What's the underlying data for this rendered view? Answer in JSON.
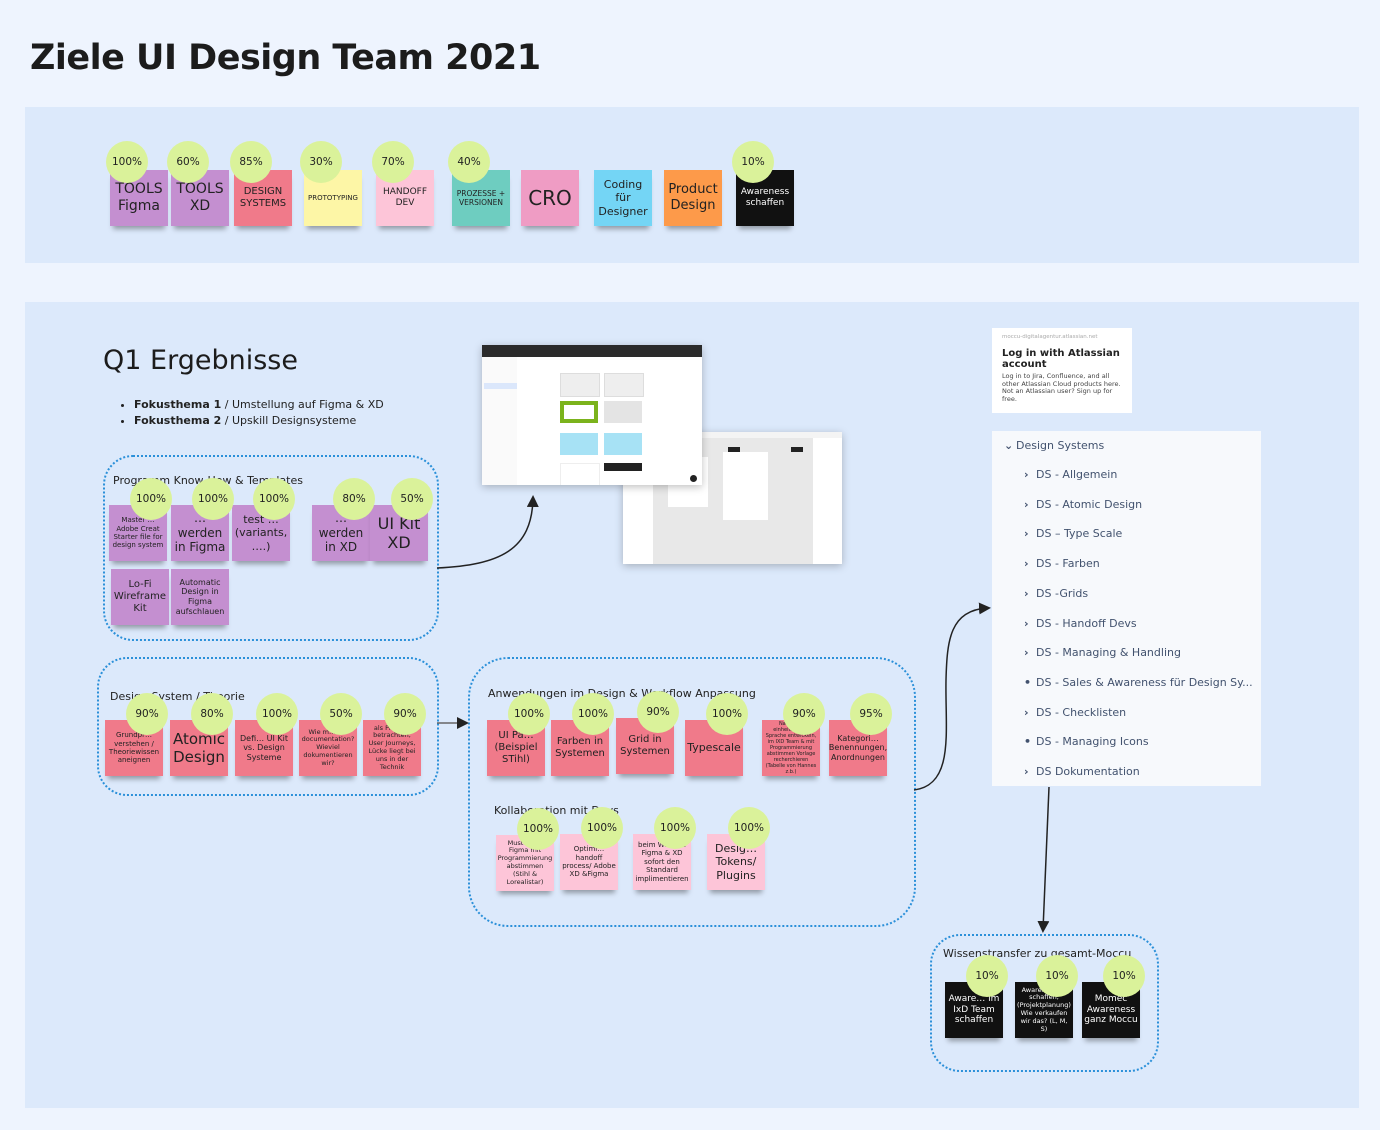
{
  "title": "Ziele UI Design Team 2021",
  "goals": [
    {
      "label": "TOOLS Figma",
      "progress": "100%",
      "color": "#c48fd0"
    },
    {
      "label": "TOOLS XD",
      "progress": "60%",
      "color": "#c48fd0"
    },
    {
      "label": "DESIGN SYSTEMS",
      "progress": "85%",
      "color": "#f07a8a"
    },
    {
      "label": "PROTOTYPING",
      "progress": "30%",
      "color": "#fdf6a6"
    },
    {
      "label": "HANDOFF DEV",
      "progress": "70%",
      "color": "#fdc5d8"
    },
    {
      "label": "PROZESSE + VERSIONEN",
      "progress": "40%",
      "color": "#6ecdc0"
    },
    {
      "label": "CRO",
      "progress": null,
      "color": "#ef9cc4"
    },
    {
      "label": "Coding für Designer",
      "progress": null,
      "color": "#74d5f5"
    },
    {
      "label": "Product Design",
      "progress": null,
      "color": "#fd9a4a"
    },
    {
      "label": "Awareness schaffen",
      "progress": "10%",
      "color": "#111111"
    }
  ],
  "q1": {
    "heading": "Q1 Ergebnisse",
    "bullets": [
      {
        "bold": "Fokusthema 1",
        "text": " / Umstellung auf Figma & XD"
      },
      {
        "bold": "Fokusthema 2",
        "text": " / Upskill Designsysteme"
      }
    ]
  },
  "groups": {
    "programm": {
      "label": "Programm Know-How & Templates",
      "stickies": [
        {
          "text": "Master … Adobe Creat Starter file for design system",
          "progress": "100%"
        },
        {
          "text": "… werden in Figma",
          "progress": "100%"
        },
        {
          "text": "test … (variants, ….)",
          "progress": "100%"
        },
        {
          "text": "… werden in XD",
          "progress": "80%"
        },
        {
          "text": "UI Kit XD",
          "progress": "50%"
        },
        {
          "text": "Lo-Fi Wireframe Kit",
          "progress": null
        },
        {
          "text": "Automatic Design in Figma aufschlauen",
          "progress": null
        }
      ]
    },
    "theorie": {
      "label": "Design System / Theorie",
      "stickies": [
        {
          "text": "Grundpr… verstehen / Theoriewissen aneignen",
          "progress": "90%"
        },
        {
          "text": "Atomic Design",
          "progress": "80%"
        },
        {
          "text": "Defi… UI Kit vs. Design Systeme",
          "progress": "100%"
        },
        {
          "text": "Wie m… die documentation? Wieviel dokumentieren wir?",
          "progress": "50%"
        },
        {
          "text": "als Produ… betrachten, User Journeys, Lücke liegt bei uns in der Technik",
          "progress": "90%"
        }
      ]
    },
    "anwendungen": {
      "label": "Anwendungen im Design & Workflow Anpassung",
      "stickies": [
        {
          "text": "UI Pa… (Beispiel STihl)",
          "progress": "100%"
        },
        {
          "text": "Farben in Systemen",
          "progress": "100%"
        },
        {
          "text": "Grid in Systemen",
          "progress": "90%"
        },
        {
          "text": "Typescale",
          "progress": "100%"
        },
        {
          "text": "Na… eine einheitliche … Sprache entwickeln, im IXD Team & mit Programmierung abstimmen Vorlage recherchieren (Tabelle von Hannes z.b.)",
          "progress": "90%"
        },
        {
          "text": "Kategori… Benennungen, Anordnungen",
          "progress": "95%"
        }
      ]
    },
    "kollaboration": {
      "label": "Kollaboration mit Devs",
      "stickies": [
        {
          "text": "Muster F… Figma mit Programmierung abstimmen (Stihl & Lorealistar)",
          "progress": "100%"
        },
        {
          "text": "Optimi… handoff process/ Adobe XD &Figma",
          "progress": "100%"
        },
        {
          "text": "beim We… zu Figma & XD sofort den Standard implimentieren",
          "progress": "100%"
        },
        {
          "text": "Desig… Tokens/ Plugins",
          "progress": "100%"
        }
      ]
    },
    "wissen": {
      "label": "Wissenstransfer zu gesamt-Moccu",
      "stickies": [
        {
          "text": "Aware… im IxD Team schaffen",
          "progress": "10%"
        },
        {
          "text": "Aware… PM´s schaffen, (Projektplanung) Wie verkaufen wir das? (L, M, S)",
          "progress": "10%"
        },
        {
          "text": "Momec Awareness ganz Moccu",
          "progress": "10%"
        }
      ]
    }
  },
  "login": {
    "domain": "moccu-digitalagentur.atlassian.net",
    "heading": "Log in with Atlassian account",
    "text": "Log in to Jira, Confluence, and all other Atlassian Cloud products here. Not an Atlassian user? Sign up for free."
  },
  "tree": {
    "root": "Design Systems",
    "items": [
      {
        "label": "DS - Allgemein",
        "marker": "chevron"
      },
      {
        "label": "DS - Atomic Design",
        "marker": "chevron"
      },
      {
        "label": "DS – Type Scale",
        "marker": "chevron"
      },
      {
        "label": "DS - Farben",
        "marker": "chevron"
      },
      {
        "label": "DS -Grids",
        "marker": "chevron"
      },
      {
        "label": "DS - Handoff Devs",
        "marker": "chevron"
      },
      {
        "label": "DS - Managing & Handling",
        "marker": "chevron"
      },
      {
        "label": "DS - Sales & Awareness für Design Sy...",
        "marker": "bullet"
      },
      {
        "label": "DS - Checklisten",
        "marker": "chevron"
      },
      {
        "label": "DS - Managing Icons",
        "marker": "bullet"
      },
      {
        "label": "DS Dokumentation",
        "marker": "chevron"
      }
    ]
  }
}
